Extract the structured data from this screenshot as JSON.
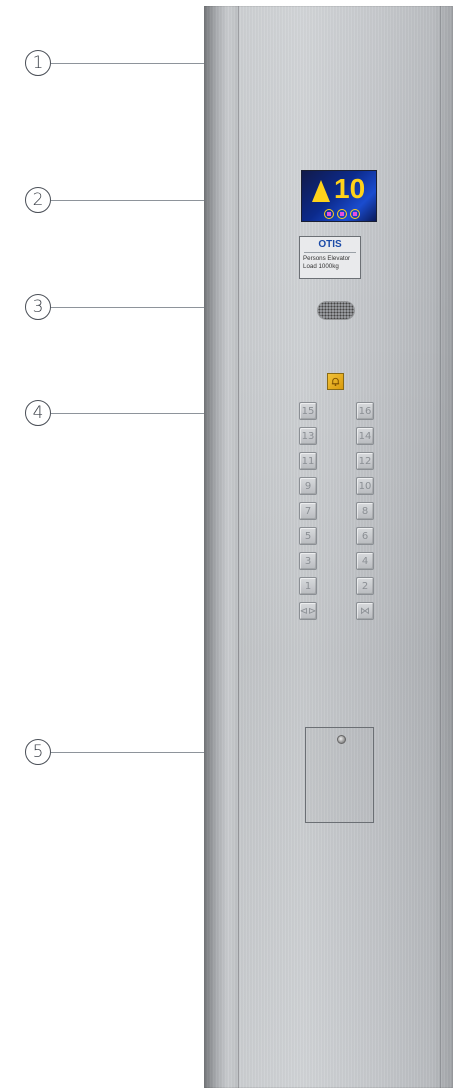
{
  "callouts": [
    "1",
    "2",
    "3",
    "4",
    "5"
  ],
  "display": {
    "direction_icon": "up-arrow-icon",
    "floor": "10"
  },
  "plate": {
    "brand": "OTIS",
    "line1": "Persons Elevator",
    "line2": "Load 1000kg"
  },
  "alarm": {
    "icon": "bell-icon"
  },
  "buttons": {
    "left": [
      "15",
      "13",
      "11",
      "9",
      "7",
      "5",
      "3",
      "1",
      "⊲⊳"
    ],
    "right": [
      "16",
      "14",
      "12",
      "10",
      "8",
      "6",
      "4",
      "2",
      "⋈"
    ]
  },
  "colors": {
    "accent_yellow": "#ffd21a",
    "display_blue": "#0c2a8c",
    "brand_blue": "#1a4aa8",
    "alarm": "#e0a414"
  }
}
